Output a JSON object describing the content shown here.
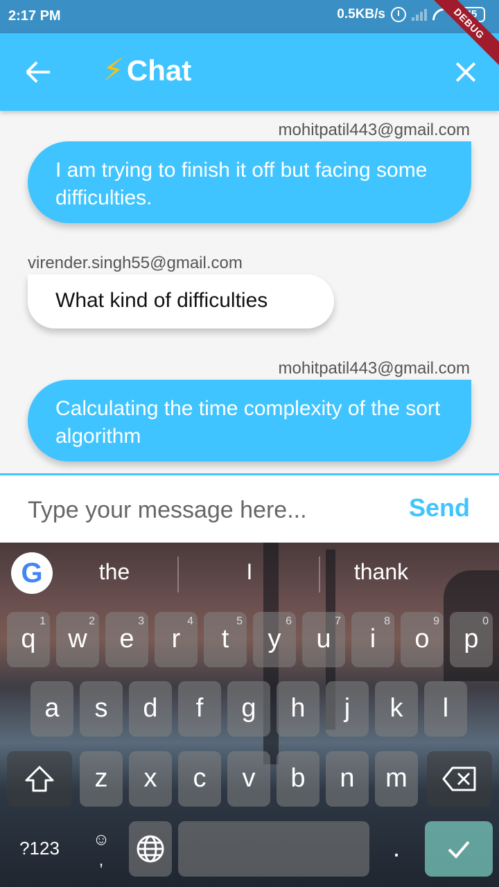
{
  "status": {
    "time": "2:17 PM",
    "net_speed": "0.5KB/s",
    "battery": "45",
    "debug": "DEBUG"
  },
  "appbar": {
    "title": "Chat",
    "bolt": "⚡"
  },
  "messages": [
    {
      "sender": "mohitpatil443@gmail.com",
      "text": "I am trying to finish it off but facing some difficulties.",
      "mine": true
    },
    {
      "sender": "virender.singh55@gmail.com",
      "text": "What kind of difficulties",
      "mine": false
    },
    {
      "sender": "mohitpatil443@gmail.com",
      "text": "Calculating the time complexity of the sort algorithm",
      "mine": true
    }
  ],
  "input": {
    "placeholder": "Type your message here...",
    "send_label": "Send"
  },
  "keyboard": {
    "suggestions": [
      "the",
      "I",
      "thank"
    ],
    "row1": [
      {
        "k": "q",
        "h": "1"
      },
      {
        "k": "w",
        "h": "2"
      },
      {
        "k": "e",
        "h": "3"
      },
      {
        "k": "r",
        "h": "4"
      },
      {
        "k": "t",
        "h": "5"
      },
      {
        "k": "y",
        "h": "6"
      },
      {
        "k": "u",
        "h": "7"
      },
      {
        "k": "i",
        "h": "8"
      },
      {
        "k": "o",
        "h": "9"
      },
      {
        "k": "p",
        "h": "0"
      }
    ],
    "row2": [
      "a",
      "s",
      "d",
      "f",
      "g",
      "h",
      "j",
      "k",
      "l"
    ],
    "row3": [
      "z",
      "x",
      "c",
      "v",
      "b",
      "n",
      "m"
    ],
    "symbols_label": "?123",
    "emoji_label": "☺",
    "comma_label": ",",
    "period_label": ".",
    "accent": "#40c4ff"
  }
}
